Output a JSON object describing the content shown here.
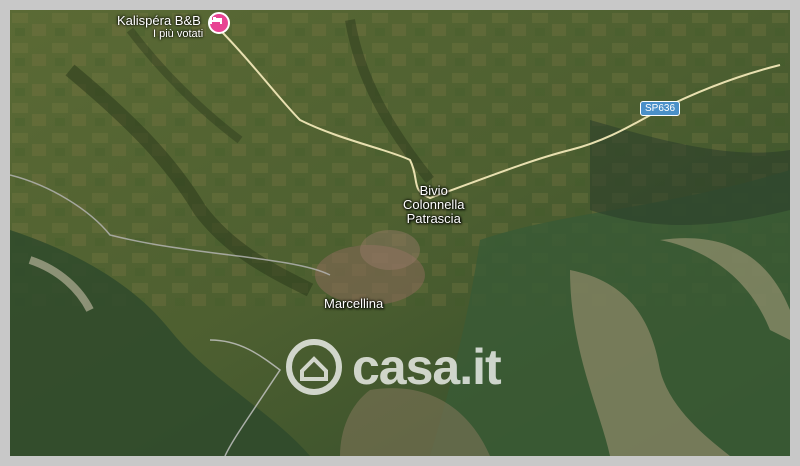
{
  "map": {
    "style": "satellite",
    "poi": {
      "name": "Kalispéra B&B",
      "subtitle": "I più votati",
      "icon": "bed-icon",
      "pin_color": "#e84393"
    },
    "road_shield": {
      "label": "SP636",
      "color": "#4a90c8"
    },
    "places": [
      {
        "id": "bivio",
        "lines": [
          "Bivio",
          "Colonnella",
          "Patrascia"
        ]
      },
      {
        "id": "marcellina",
        "lines": [
          "Marcellina"
        ]
      }
    ]
  },
  "watermark": {
    "brand": "casa.it",
    "icon": "house-logo-icon"
  }
}
